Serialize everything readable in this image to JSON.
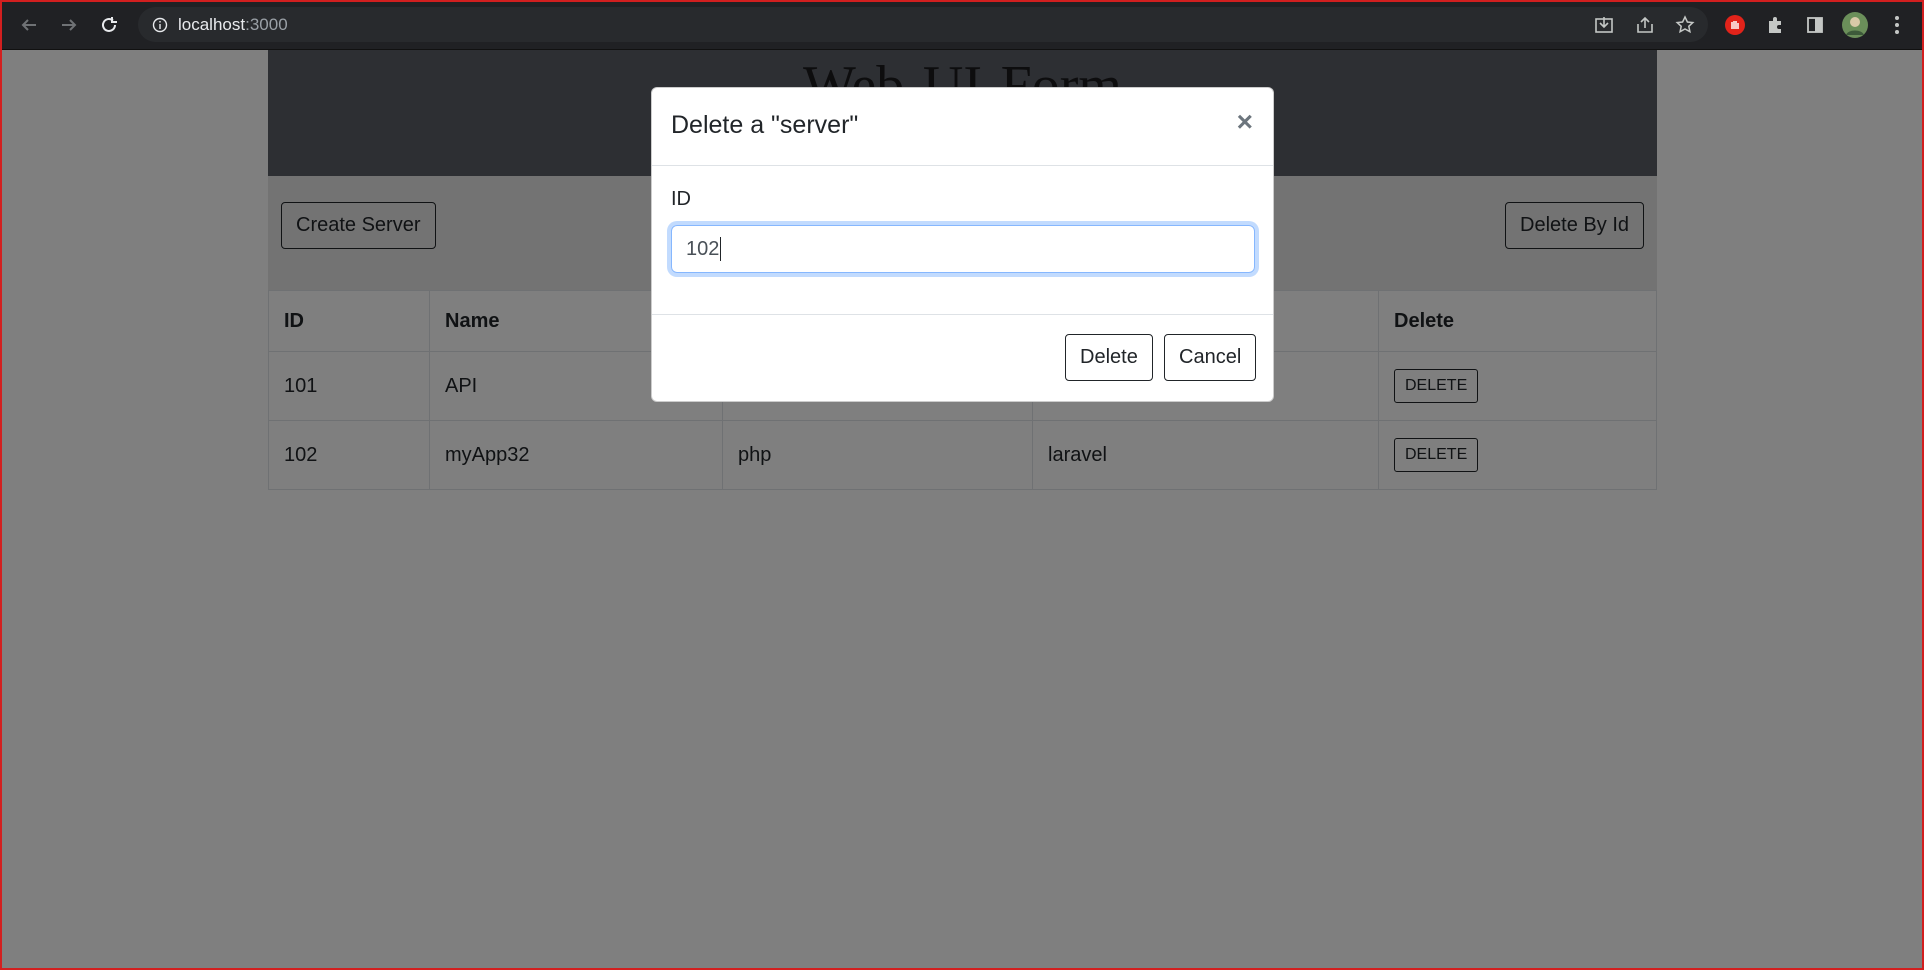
{
  "browser": {
    "url_host": "localhost",
    "url_port": ":3000"
  },
  "page": {
    "title": "Web-UI-Form",
    "toolbar": {
      "create_label": "Create Server",
      "delete_by_id_label": "Delete By Id"
    },
    "table": {
      "headers": [
        "ID",
        "Name",
        "",
        "",
        "Delete"
      ],
      "rows": [
        [
          "101",
          "API",
          "",
          "",
          "DELETE"
        ],
        [
          "102",
          "myApp32",
          "php",
          "laravel",
          "DELETE"
        ]
      ]
    }
  },
  "modal": {
    "title": "Delete a \"server\"",
    "close_symbol": "×",
    "field_label": "ID",
    "field_value": "102",
    "delete_label": "Delete",
    "cancel_label": "Cancel"
  },
  "colors": {
    "frame_border": "#d21f1f",
    "chrome_bg": "#202124",
    "focus_ring": "#86b7fe"
  }
}
